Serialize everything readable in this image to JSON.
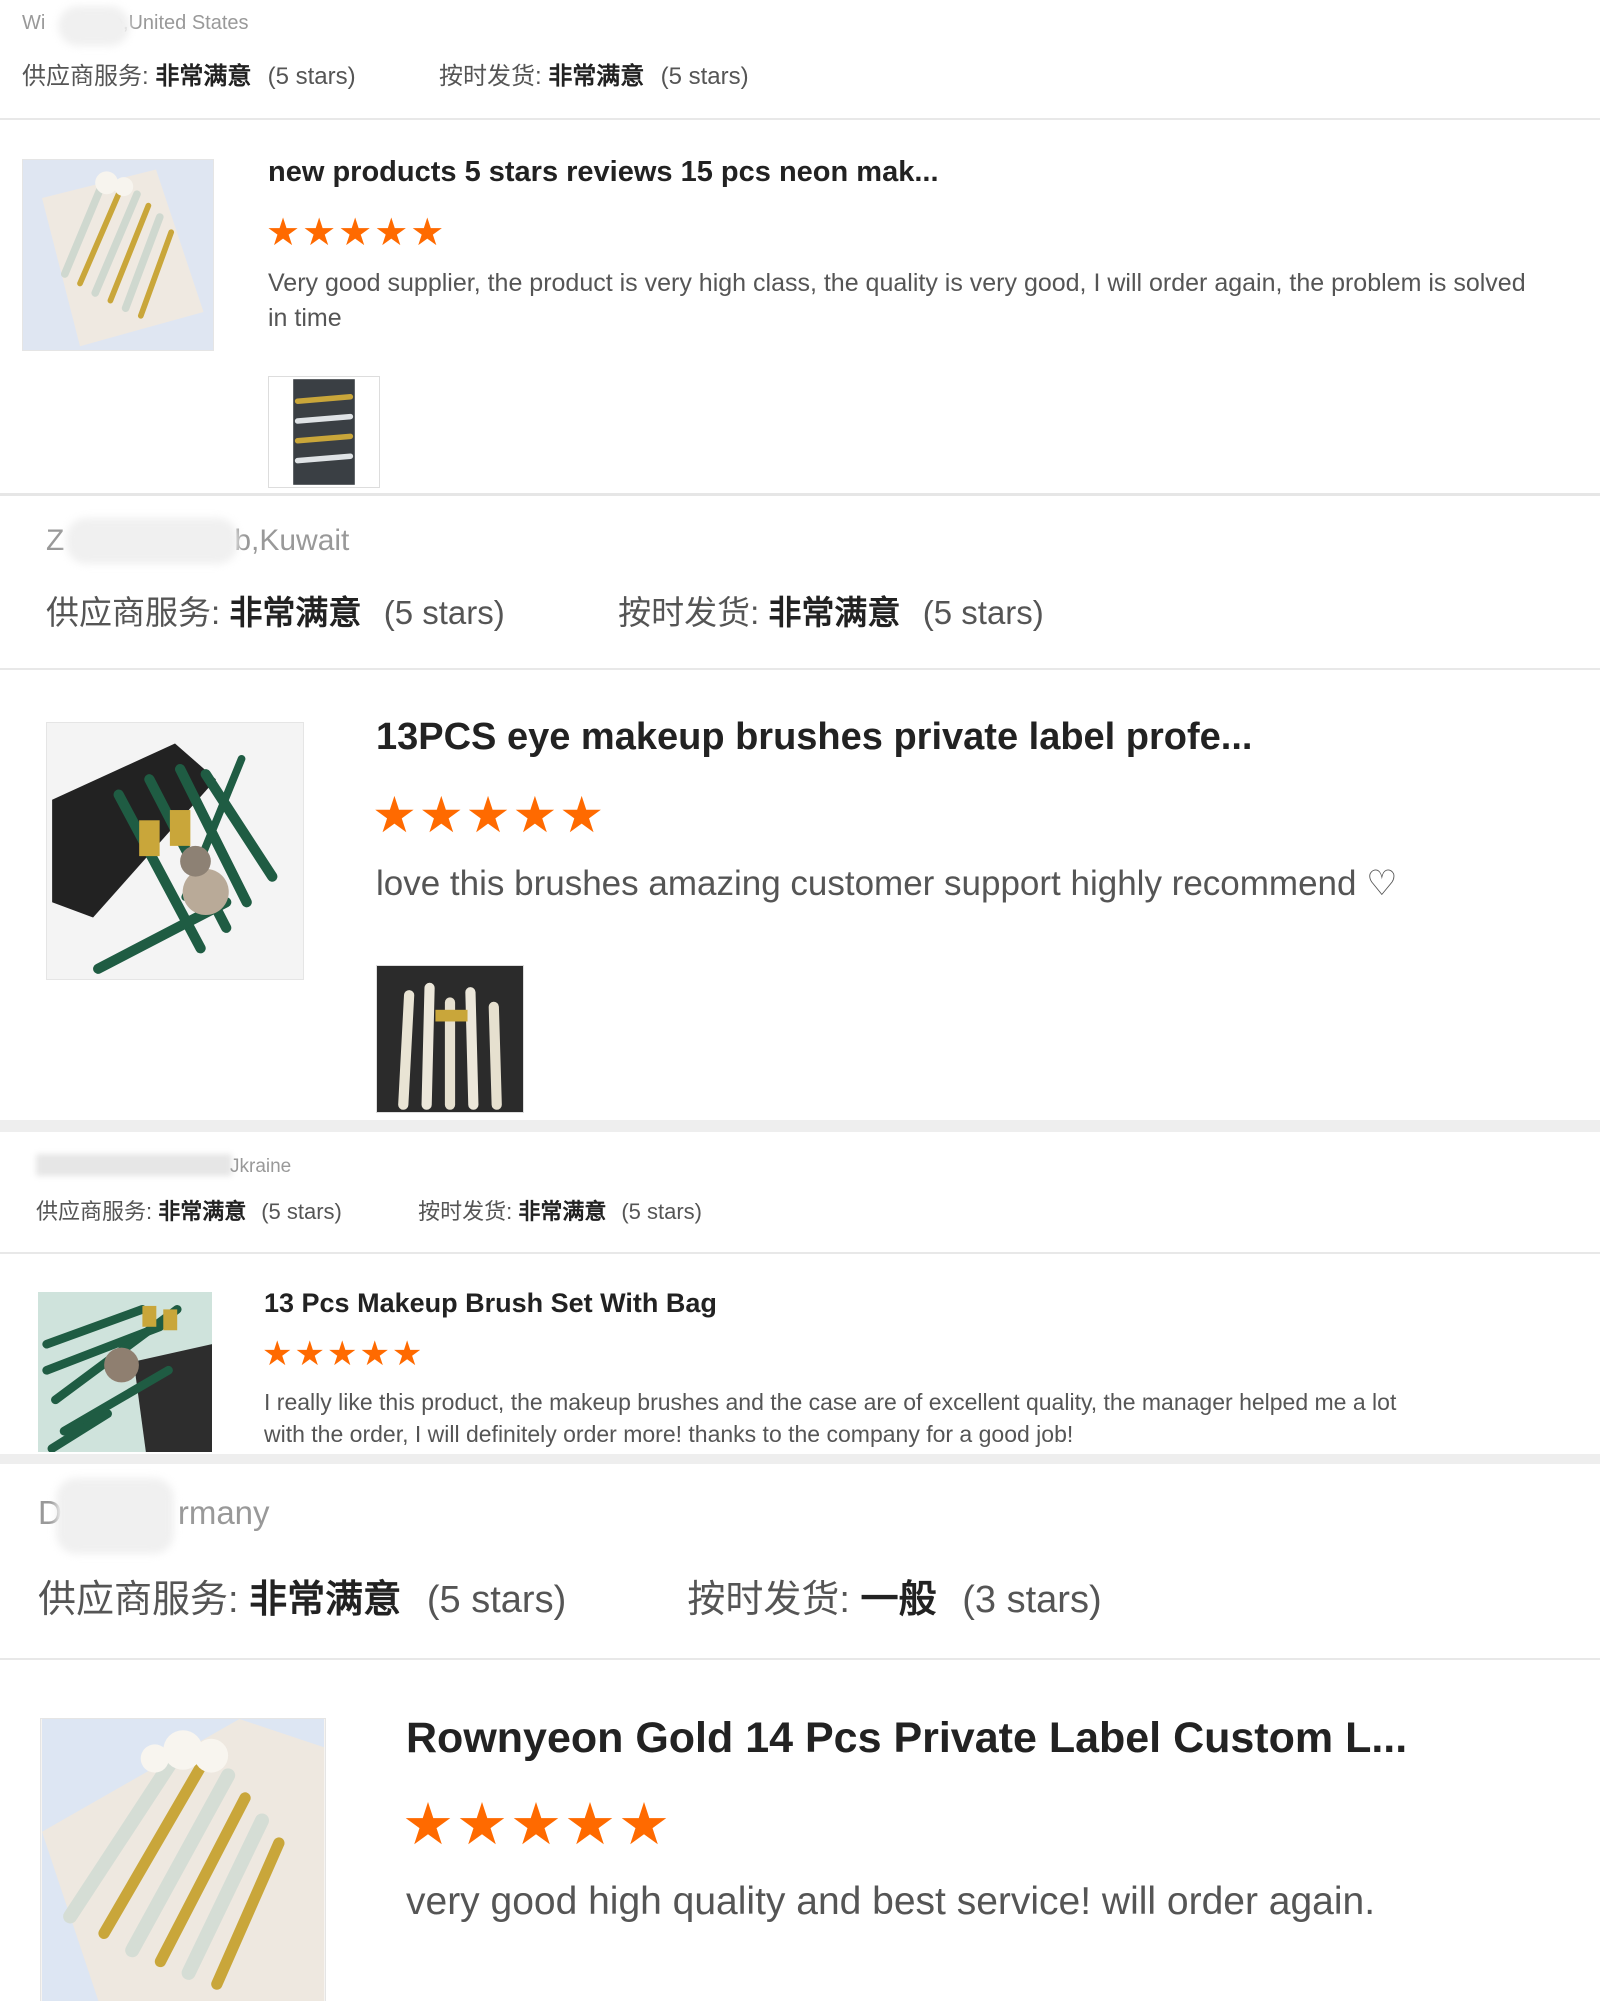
{
  "reviews": [
    {
      "location": "le,United States",
      "location_prefix": "Wi",
      "supplier_label": "供应商服务:",
      "supplier_value": "非常满意",
      "supplier_stars": "(5 stars)",
      "delivery_label": "按时发货:",
      "delivery_value": "非常满意",
      "delivery_stars": "(5 stars)",
      "product_title": "new products 5 stars reviews 15 pcs neon mak...",
      "stars": "★★★★★",
      "text": "Very good supplier, the product is very high class, the quality is very good, I will order again, the problem is solved in time"
    },
    {
      "location": "b,Kuwait",
      "location_prefix": "Z",
      "supplier_label": "供应商服务:",
      "supplier_value": "非常满意",
      "supplier_stars": "(5 stars)",
      "delivery_label": "按时发货:",
      "delivery_value": "非常满意",
      "delivery_stars": "(5 stars)",
      "product_title": "13PCS eye makeup brushes private label profe...",
      "stars": "★★★★★",
      "text": "love this brushes amazing customer support highly recommend ♡"
    },
    {
      "location": "Jkraine",
      "supplier_label": "供应商服务:",
      "supplier_value": "非常满意",
      "supplier_stars": "(5 stars)",
      "delivery_label": "按时发货:",
      "delivery_value": "非常满意",
      "delivery_stars": "(5 stars)",
      "product_title": "13 Pcs Makeup Brush Set With Bag",
      "stars": "★★★★★",
      "text": "I really like this product, the makeup brushes and the case are of excellent quality, the manager helped me a lot with the order, I will definitely order more!  thanks to the company for a good job!"
    },
    {
      "location": "rmany",
      "location_prefix": "D",
      "supplier_label": "供应商服务:",
      "supplier_value": "非常满意",
      "supplier_stars": "(5 stars)",
      "delivery_label": "按时发货:",
      "delivery_value": "一般",
      "delivery_stars": "(3 stars)",
      "product_title": "Rownyeon Gold 14 Pcs Private Label Custom L...",
      "stars": "★★★★★",
      "text": "very good high quality and best service! will order again."
    }
  ],
  "colors": {
    "star": "#ff6a00",
    "divider": "#e6e6e6",
    "brush_green": "#1f5c43",
    "brush_gold": "#c9a63a"
  }
}
